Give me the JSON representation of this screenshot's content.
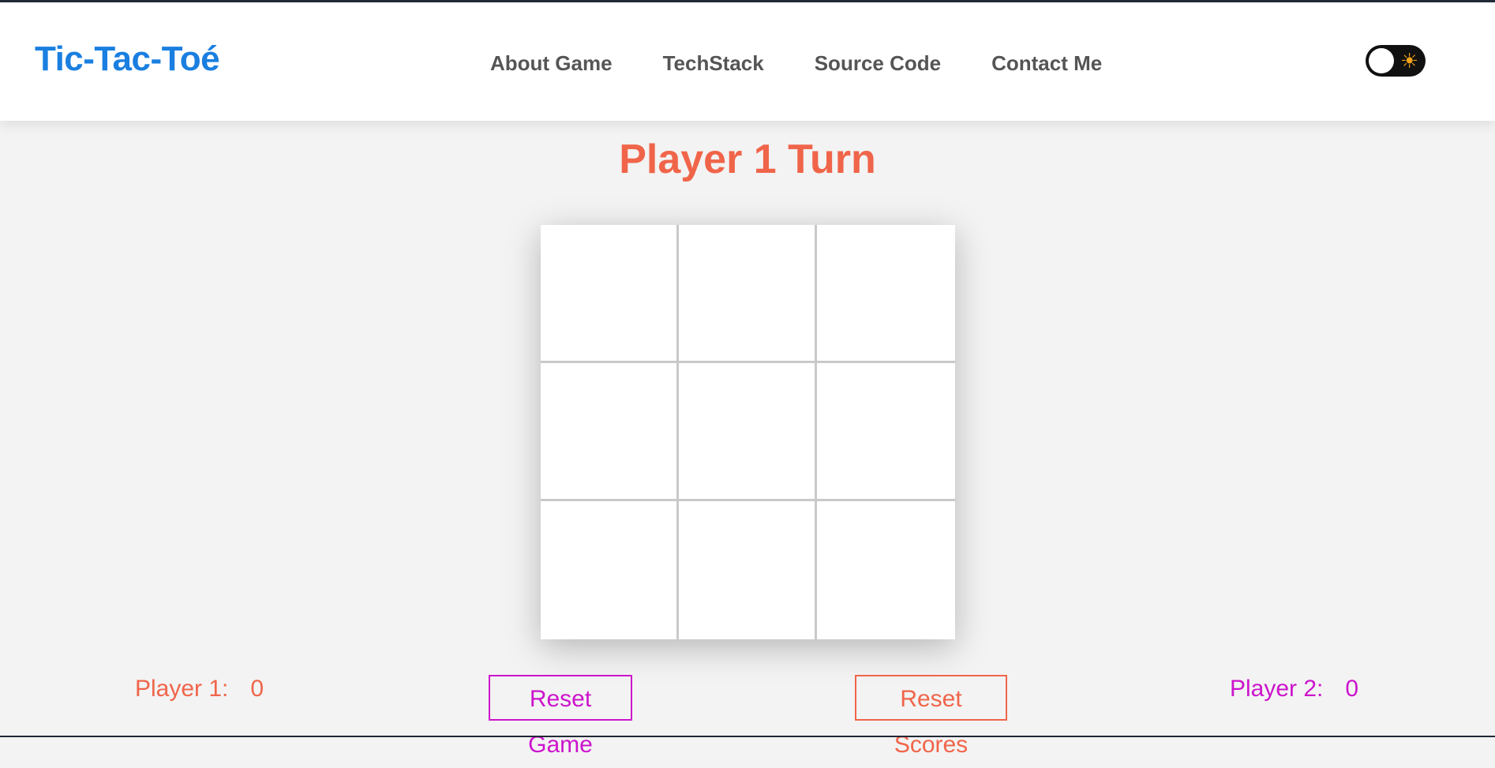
{
  "header": {
    "brand": "Tic-Tac-Toé",
    "nav": [
      {
        "label": "About Game"
      },
      {
        "label": "TechStack"
      },
      {
        "label": "Source Code"
      },
      {
        "label": "Contact Me"
      }
    ],
    "theme_toggle": {
      "icon": "sun-icon",
      "state": "light"
    }
  },
  "game": {
    "turn_text": "Player 1 Turn",
    "board": [
      "",
      "",
      "",
      "",
      "",
      "",
      "",
      "",
      ""
    ]
  },
  "scores": {
    "player1": {
      "label": "Player 1:",
      "value": "0"
    },
    "player2": {
      "label": "Player 2:",
      "value": "0"
    }
  },
  "buttons": {
    "reset_game": "Reset Game",
    "reset_scores": "Reset Scores"
  },
  "colors": {
    "brand": "#1a7fe0",
    "player1": "#f0654a",
    "player2": "#cc14cc",
    "nav_text": "#555555",
    "background": "#f3f3f3"
  }
}
